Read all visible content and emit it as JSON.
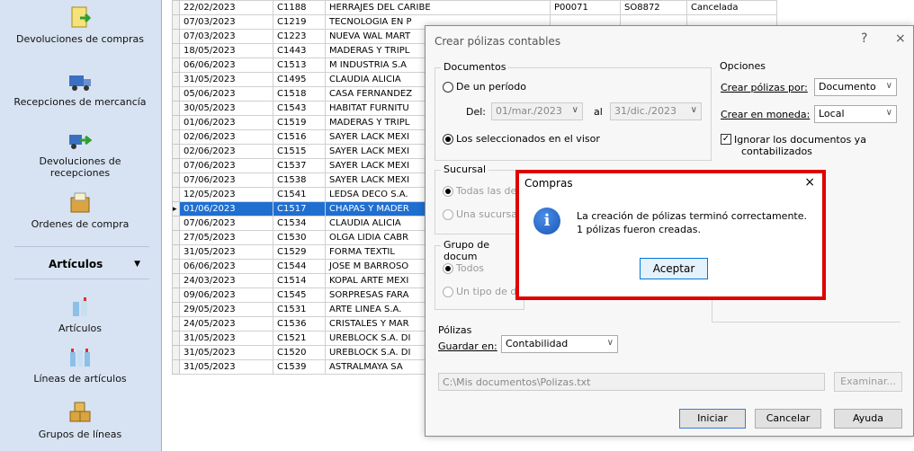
{
  "sidebar": {
    "items": [
      {
        "label": "Devoluciones de compras",
        "icon": "document-return-icon"
      },
      {
        "label": "Recepciones de mercancía",
        "icon": "truck-icon"
      },
      {
        "label": "Devoluciones de recepciones",
        "icon": "truck-return-icon"
      },
      {
        "label": "Ordenes de compra",
        "icon": "box-order-icon"
      }
    ],
    "section": {
      "label": "Artículos",
      "icon": "chevron-down-icon"
    },
    "section_items": [
      {
        "label": "Artículos",
        "icon": "bottles-icon"
      },
      {
        "label": "Líneas de artículos",
        "icon": "bottles-line-icon"
      },
      {
        "label": "Grupos de líneas",
        "icon": "boxes-icon"
      }
    ]
  },
  "grid": {
    "rows": [
      [
        "22/02/2023",
        "C1188",
        "HERRAJES DEL CARIBE",
        "P00071",
        "SO8872",
        "Cancelada"
      ],
      [
        "07/03/2023",
        "C1219",
        "TECNOLOGIA EN P",
        "",
        "",
        ""
      ],
      [
        "07/03/2023",
        "C1223",
        "NUEVA WAL MART",
        "",
        "",
        ""
      ],
      [
        "18/05/2023",
        "C1443",
        "MADERAS Y TRIPL",
        "",
        "",
        ""
      ],
      [
        "06/06/2023",
        "C1513",
        "M INDUSTRIA S.A",
        "",
        "",
        ""
      ],
      [
        "31/05/2023",
        "C1495",
        "CLAUDIA ALICIA",
        "",
        "",
        ""
      ],
      [
        "05/06/2023",
        "C1518",
        "CASA FERNANDEZ",
        "",
        "",
        ""
      ],
      [
        "30/05/2023",
        "C1543",
        "HABITAT FURNITU",
        "",
        "",
        ""
      ],
      [
        "01/06/2023",
        "C1519",
        "MADERAS Y TRIPL",
        "",
        "",
        ""
      ],
      [
        "02/06/2023",
        "C1516",
        "SAYER LACK MEXI",
        "",
        "",
        ""
      ],
      [
        "02/06/2023",
        "C1515",
        "SAYER LACK MEXI",
        "",
        "",
        ""
      ],
      [
        "07/06/2023",
        "C1537",
        "SAYER LACK MEXI",
        "",
        "",
        ""
      ],
      [
        "07/06/2023",
        "C1538",
        "SAYER LACK MEXI",
        "",
        "",
        ""
      ],
      [
        "12/05/2023",
        "C1541",
        "LEDSA DECO S.A.",
        "",
        "",
        ""
      ],
      [
        "01/06/2023",
        "C1517",
        "CHAPAS Y MADER",
        "",
        "",
        ""
      ],
      [
        "07/06/2023",
        "C1534",
        "CLAUDIA ALICIA",
        "",
        "",
        ""
      ],
      [
        "27/05/2023",
        "C1530",
        "OLGA LIDIA CABR",
        "",
        "",
        ""
      ],
      [
        "31/05/2023",
        "C1529",
        "FORMA TEXTIL",
        "",
        "",
        ""
      ],
      [
        "06/06/2023",
        "C1544",
        "JOSE M BARROSO",
        "",
        "",
        ""
      ],
      [
        "24/03/2023",
        "C1514",
        "KOPAL ARTE MEXI",
        "",
        "",
        ""
      ],
      [
        "09/06/2023",
        "C1545",
        "SORPRESAS FARA",
        "",
        "",
        ""
      ],
      [
        "29/05/2023",
        "C1531",
        "ARTE LINEA S.A.",
        "",
        "",
        ""
      ],
      [
        "24/05/2023",
        "C1536",
        "CRISTALES Y MAR",
        "",
        "",
        ""
      ],
      [
        "31/05/2023",
        "C1521",
        "UREBLOCK S.A. DI",
        "",
        "",
        ""
      ],
      [
        "31/05/2023",
        "C1520",
        "UREBLOCK S.A. DI",
        "",
        "",
        ""
      ],
      [
        "31/05/2023",
        "C1539",
        "ASTRALMAYA SA",
        "",
        "",
        ""
      ]
    ],
    "selected_row_index": 14
  },
  "dialog": {
    "title": "Crear pólizas contables",
    "help": "?",
    "close": "×",
    "documentos": {
      "label": "Documentos",
      "periodo_label": "De un período",
      "del_label": "Del:",
      "from_date": "01/mar./2023",
      "al_label": "al",
      "to_date": "31/dic./2023",
      "seleccionados_label": "Los seleccionados en el visor"
    },
    "opciones": {
      "label": "Opciones",
      "por_label": "Crear pólizas por:",
      "por_value": "Documento",
      "moneda_label": "Crear en moneda:",
      "moneda_value": "Local",
      "ignorar_label_1": "Ignorar los documentos ya",
      "ignorar_label_2": "contabilizados"
    },
    "sucursal": {
      "label": "Sucursal",
      "todas": "Todas las de",
      "una": "Una sucursa"
    },
    "grupo": {
      "label": "Grupo de docum",
      "todos": "Todos",
      "tipo": "Un tipo de d"
    },
    "polizas": {
      "label": "Pólizas",
      "guardar_label": "Guardar en:",
      "guardar_value": "Contabilidad"
    },
    "path": "C:\\Mis documentos\\Polizas.txt",
    "examinar": "Examinar...",
    "buttons": {
      "iniciar": "Iniciar",
      "cancelar": "Cancelar",
      "ayuda": "Ayuda"
    }
  },
  "msgbox": {
    "title": "Compras",
    "close": "×",
    "line1": "La creación de pólizas terminó correctamente.",
    "line2": "1 pólizas fueron creadas.",
    "ok": "Aceptar",
    "highlight_color": "#e00000"
  }
}
